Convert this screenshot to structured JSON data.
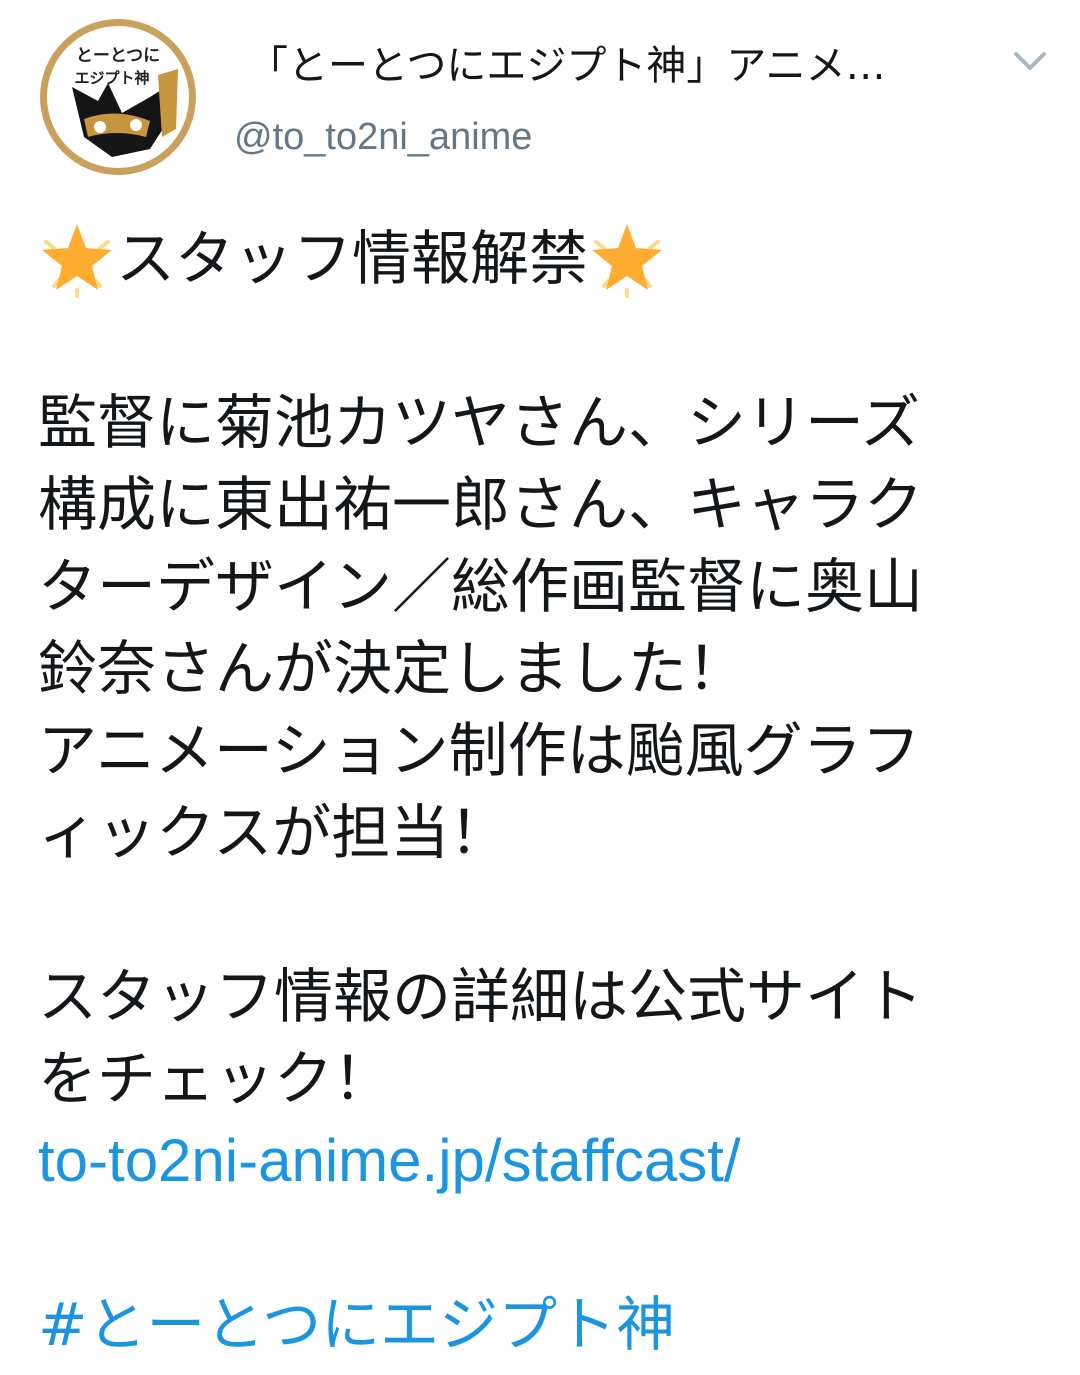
{
  "account": {
    "display_name": "「とーとつにエジプト神」アニメ…",
    "handle": "@to_to2ni_anime",
    "avatar_icon": "anime-logo-avatar",
    "avatar_text_line1": "とーとつに",
    "avatar_text_line2": "エジプト神"
  },
  "menu": {
    "icon": "chevron-down-icon"
  },
  "tweet": {
    "headline_emoji": "star-emoji",
    "headline_text": "スタッフ情報解禁",
    "lines": [
      "監督に菊池カツヤさん、シリーズ",
      "構成に東出祐一郎さん、キャラク",
      "ターデザイン／総作画監督に奥山",
      "鈴奈さんが決定しました！",
      "アニメーション制作は颱風グラフ",
      "ィックスが担当！"
    ],
    "lines2": [
      "スタッフ情報の詳細は公式サイト",
      "をチェック！"
    ],
    "link": "to-to2ni-anime.jp/staffcast/",
    "hashtag": "#とーとつにエジプト神"
  },
  "colors": {
    "link": "#1b95e0",
    "text": "#14171a",
    "secondary": "#657786",
    "star": "#ffac33"
  }
}
